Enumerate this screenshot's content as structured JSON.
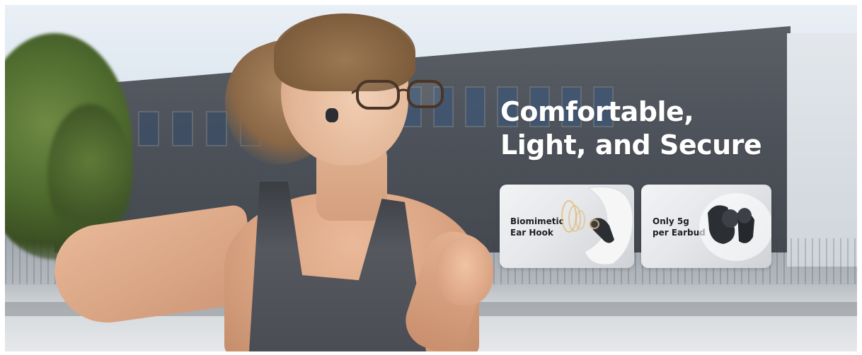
{
  "headline": {
    "line1": "Comfortable,",
    "line2": "Light, and Secure"
  },
  "features": [
    {
      "line1": "Biomimetic",
      "line2": "Ear Hook"
    },
    {
      "line1": "Only 5g",
      "line2": "per Earbud"
    }
  ],
  "colors": {
    "headline_text": "#ffffff",
    "card_text": "#1f1f22",
    "card_background": "#e5e7ea",
    "earbud": "#2b2e33"
  },
  "icons": [
    "earbud-on-ear-graphic",
    "ear-hook-graphic",
    "earbud-pair-graphic"
  ]
}
